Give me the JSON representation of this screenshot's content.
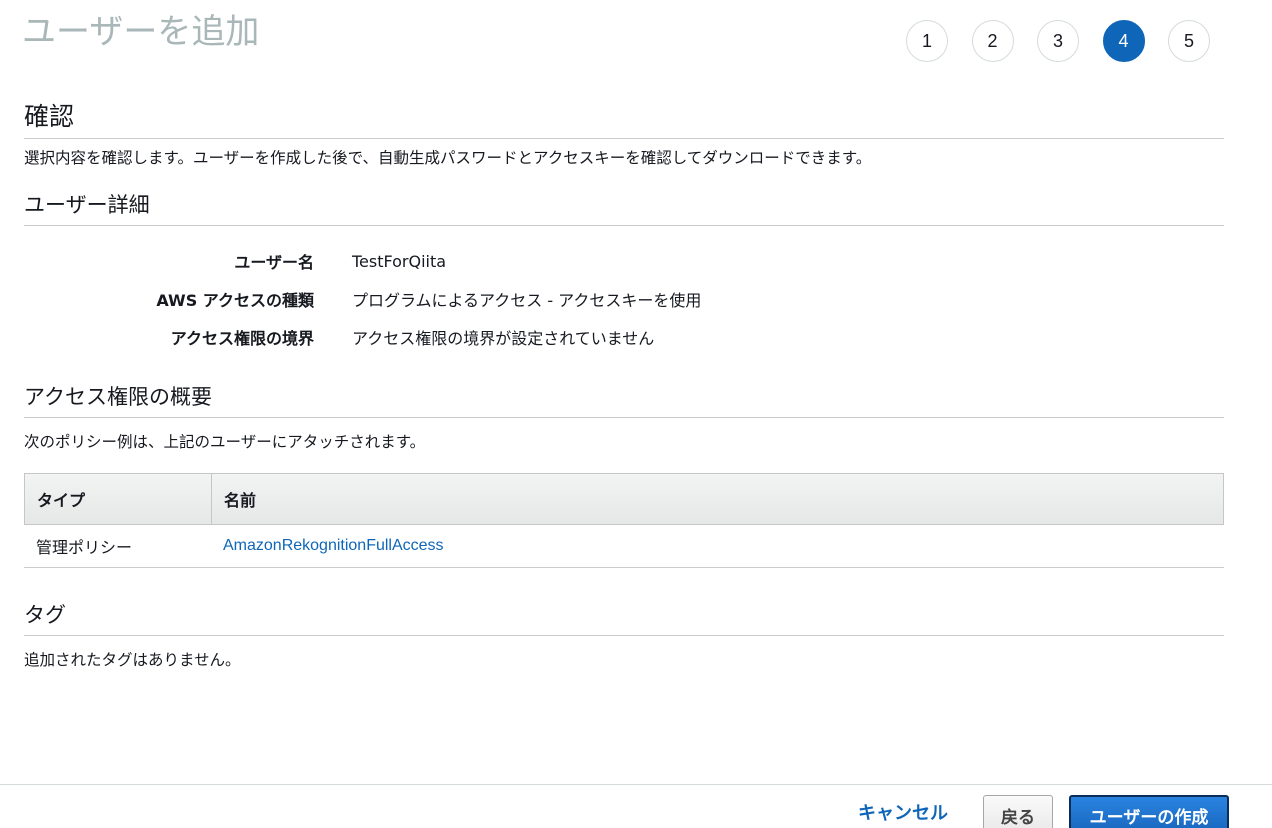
{
  "header": {
    "title": "ユーザーを追加",
    "steps": [
      {
        "label": "1",
        "active": false
      },
      {
        "label": "2",
        "active": false
      },
      {
        "label": "3",
        "active": false
      },
      {
        "label": "4",
        "active": true
      },
      {
        "label": "5",
        "active": false
      }
    ]
  },
  "review": {
    "heading": "確認",
    "description": "選択内容を確認します。ユーザーを作成した後で、自動生成パスワードとアクセスキーを確認してダウンロードできます。"
  },
  "user_details": {
    "heading": "ユーザー詳細",
    "rows": [
      {
        "key": "ユーザー名",
        "value": "TestForQiita"
      },
      {
        "key": "AWS アクセスの種類",
        "value": "プログラムによるアクセス - アクセスキーを使用"
      },
      {
        "key": "アクセス権限の境界",
        "value": "アクセス権限の境界が設定されていません"
      }
    ]
  },
  "permissions": {
    "heading": "アクセス権限の概要",
    "description": "次のポリシー例は、上記のユーザーにアタッチされます。",
    "columns": [
      "タイプ",
      "名前"
    ],
    "rows": [
      {
        "type": "管理ポリシー",
        "name": "AmazonRekognitionFullAccess"
      }
    ]
  },
  "tags": {
    "heading": "タグ",
    "empty_text": "追加されたタグはありません。"
  },
  "footer": {
    "cancel_label": "キャンセル",
    "back_label": "戻る",
    "create_label": "ユーザーの作成"
  },
  "colors": {
    "accent": "#0f66b8",
    "title_gray": "#aab7b8"
  }
}
